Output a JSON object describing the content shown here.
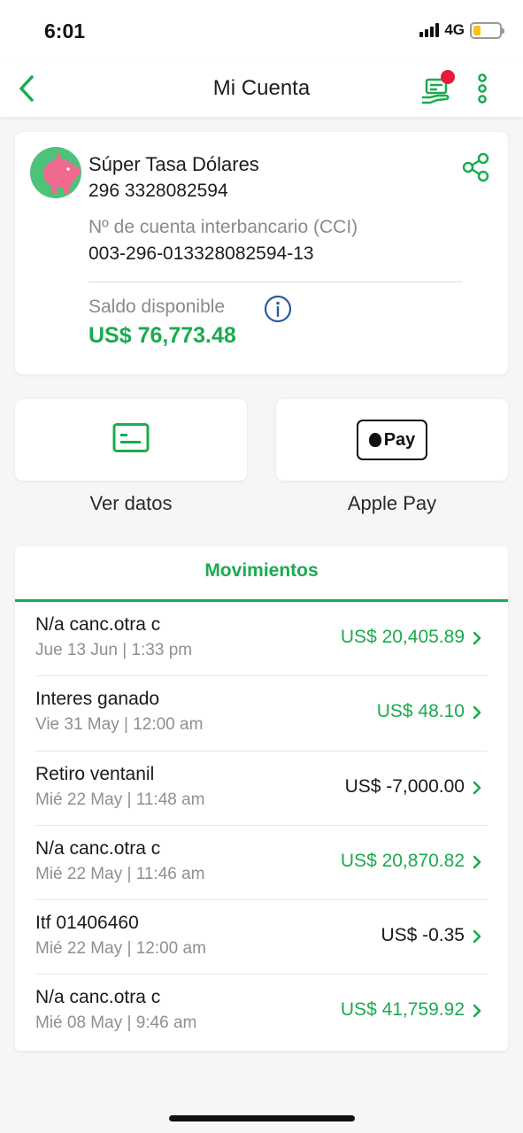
{
  "status_bar": {
    "time": "6:01",
    "network": "4G"
  },
  "nav": {
    "title": "Mi Cuenta",
    "back_icon": "chevron-left-icon",
    "card_icon": "card-hand-icon",
    "more_icon": "vertical-dots-icon"
  },
  "account": {
    "name": "Súper Tasa Dólares",
    "number": "296 3328082594",
    "cci_label": "Nº de cuenta interbancario (CCI)",
    "cci_value": "003-296-013328082594-13",
    "balance_label": "Saldo disponible",
    "balance_value": "US$ 76,773.48",
    "avatar_icon": "piggy-bank-icon",
    "share_icon": "share-icon",
    "info_icon": "info-icon"
  },
  "actions": [
    {
      "label": "Ver datos",
      "icon": "card-details-icon"
    },
    {
      "label": "Apple Pay",
      "icon": "apple-pay-icon",
      "badge_text": "Pay"
    }
  ],
  "movements": {
    "tab_label": "Movimientos",
    "items": [
      {
        "title": "N/a canc.otra c",
        "date": "Jue 13 Jun | 1:33 pm",
        "amount": "US$ 20,405.89",
        "sign": "positive"
      },
      {
        "title": "Interes ganado",
        "date": "Vie 31 May | 12:00 am",
        "amount": "US$ 48.10",
        "sign": "positive"
      },
      {
        "title": "Retiro ventanil",
        "date": "Mié 22 May | 11:48 am",
        "amount": "US$ -7,000.00",
        "sign": "negative"
      },
      {
        "title": "N/a canc.otra c",
        "date": "Mié 22 May | 11:46 am",
        "amount": "US$ 20,870.82",
        "sign": "positive"
      },
      {
        "title": "Itf 01406460",
        "date": "Mié 22 May | 12:00 am",
        "amount": "US$ -0.35",
        "sign": "negative"
      },
      {
        "title": "N/a canc.otra c",
        "date": "Mié 08 May | 9:46 am",
        "amount": "US$ 41,759.92",
        "sign": "positive"
      }
    ]
  },
  "colors": {
    "brand_green": "#1aab4f",
    "notification_red": "#e8193c",
    "avatar_green": "#4fc27a",
    "piggy_pink": "#f06a8f",
    "info_blue": "#2c5aa0"
  }
}
